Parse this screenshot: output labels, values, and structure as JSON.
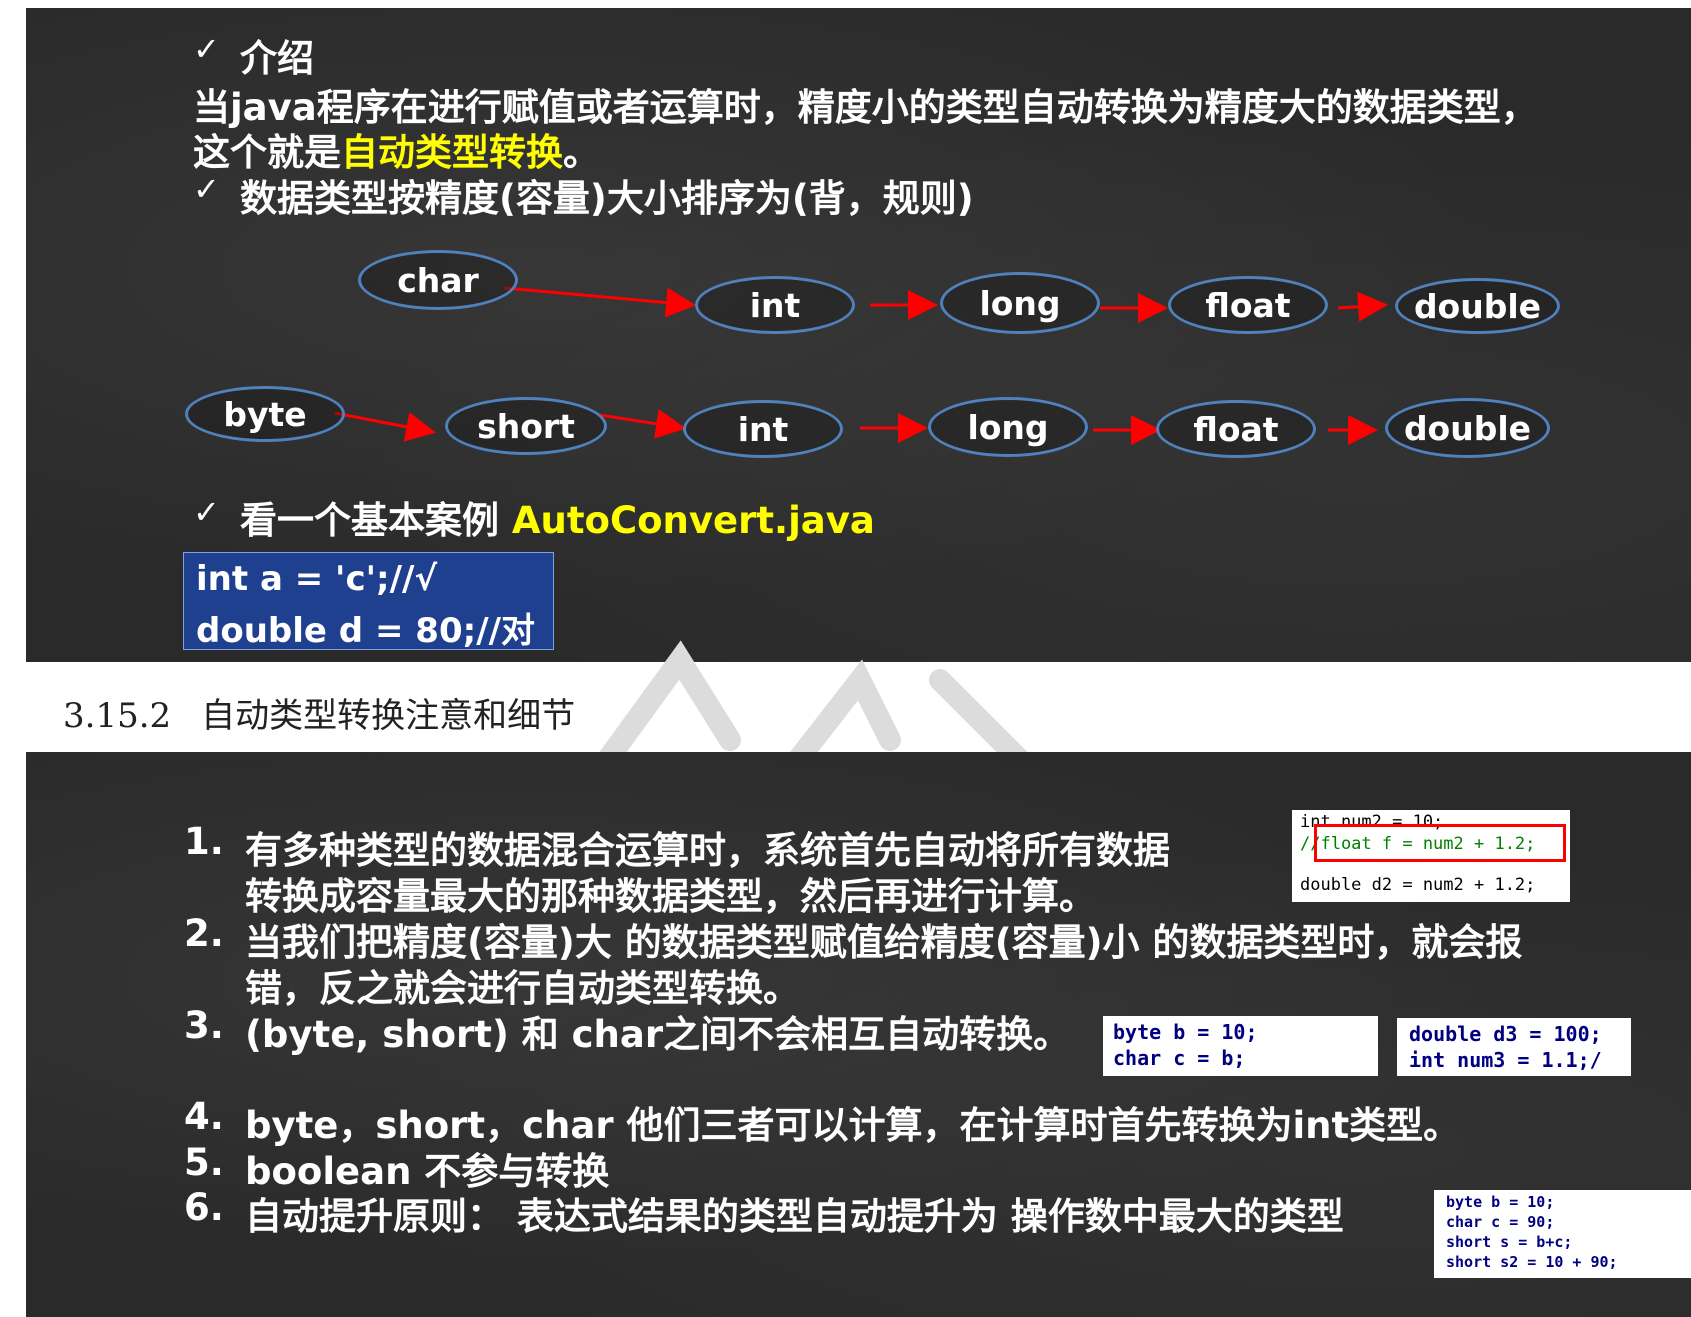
{
  "top": {
    "intro_title": "介绍",
    "intro_line1": "当java程序在进行赋值或者运算时，精度小的类型自动转换为精度大的数据类型，",
    "intro_line2_prefix": "这个就是",
    "intro_line2_highlight": "自动类型转换",
    "intro_line2_suffix": "。",
    "order_title": "数据类型按精度(容量)大小排序为(背，规则)",
    "chain1": [
      "char",
      "int",
      "long",
      "float",
      "double"
    ],
    "chain2": [
      "byte",
      "short",
      "int",
      "long",
      "float",
      "double"
    ],
    "example_prefix": "看一个基本案例",
    "example_file": "AutoConvert.java",
    "code_lines": [
      "int a = 'c';//√",
      "double d = 80;//对"
    ]
  },
  "section": {
    "number": "3.15.2",
    "title": "自动类型转换注意和细节"
  },
  "rules": [
    {
      "num": "1.",
      "lines": [
        "有多种类型的数据混合运算时，系统首先自动将所有数据",
        "转换成容量最大的那种数据类型，然后再进行计算。"
      ]
    },
    {
      "num": "2.",
      "lines": [
        "当我们把精度(容量)大 的数据类型赋值给精度(容量)小 的数据类型时，就会报",
        "错，反之就会进行自动类型转换。"
      ]
    },
    {
      "num": "3.",
      "lines": [
        "(byte, short) 和 char之间不会相互自动转换。"
      ]
    },
    {
      "num": "4.",
      "lines": [
        "byte，short，char  他们三者可以计算，在计算时首先转换为int类型。"
      ]
    },
    {
      "num": "5.",
      "lines": [
        "boolean 不参与转换"
      ]
    },
    {
      "num": "6.",
      "lines": [
        "自动提升原则： 表达式结果的类型自动提升为 操作数中最大的类型"
      ]
    }
  ],
  "snippets": {
    "snip1": [
      "int num2 = 10;",
      "//float f = num2 + 1.2;",
      "double d2 = num2 + 1.2;"
    ],
    "snip2": [
      "byte b = 10;",
      "char c = b;"
    ],
    "snip3": [
      "double d3 = 100;",
      "int num3 = 1.1;/"
    ],
    "snip4": [
      "byte b = 10;",
      "char c = 90;",
      "short s = b+c;",
      "short s2 = 10 + 90;"
    ]
  },
  "colors": {
    "board": "#2a2a2a",
    "highlight": "#ffff00",
    "arrow": "#ff0000",
    "node_border": "#4f81bd",
    "code_bg": "#1f3f8f"
  }
}
